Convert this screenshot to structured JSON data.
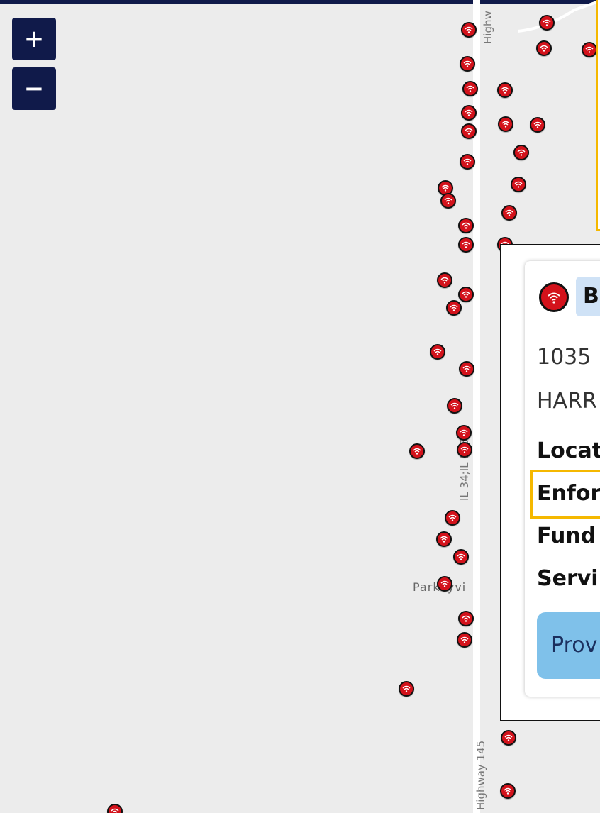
{
  "map": {
    "road_labels": {
      "top": "Highw",
      "middle": "IL 34;IL 145",
      "bottom": "Highway 145"
    },
    "town_label": "Parkeyvi",
    "zoom_in": "+",
    "zoom_out": "−",
    "marker_icon": "wifi-broadband-icon",
    "colors": {
      "marker": "#d3121b",
      "topbar": "#101a4a",
      "highlight": "#f5b800",
      "button": "#7fc1ea"
    }
  },
  "popup": {
    "badge": "B",
    "address_line1": "1035",
    "address_line2": "HARR",
    "field_location": "Locat",
    "field_enforceable": "Enfor",
    "field_funding": "Fund",
    "field_service": "Servi",
    "button_label": "Prov"
  }
}
